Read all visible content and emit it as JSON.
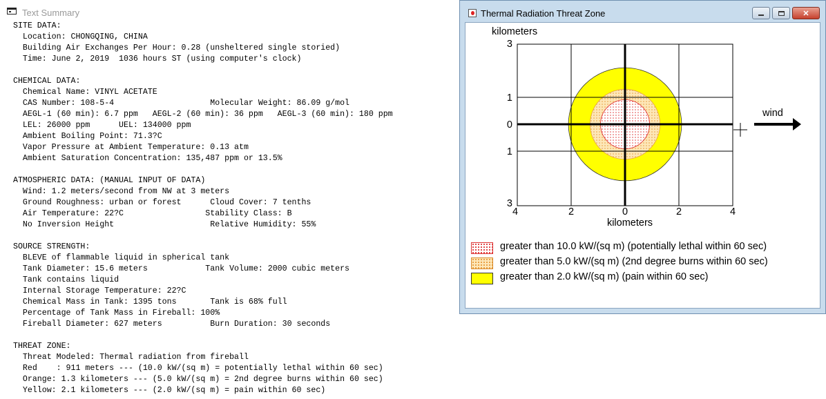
{
  "text_summary": {
    "title": "Text Summary",
    "lines": [
      "SITE DATA:",
      "  Location: CHONGQING, CHINA",
      "  Building Air Exchanges Per Hour: 0.28 (unsheltered single storied)",
      "  Time: June 2, 2019  1036 hours ST (using computer's clock)",
      "",
      "CHEMICAL DATA:",
      "  Chemical Name: VINYL ACETATE",
      "  CAS Number: 108-5-4                    Molecular Weight: 86.09 g/mol",
      "  AEGL-1 (60 min): 6.7 ppm   AEGL-2 (60 min): 36 ppm   AEGL-3 (60 min): 180 ppm",
      "  LEL: 26000 ppm      UEL: 134000 ppm",
      "  Ambient Boiling Point: 71.3?C",
      "  Vapor Pressure at Ambient Temperature: 0.13 atm",
      "  Ambient Saturation Concentration: 135,487 ppm or 13.5%",
      "",
      "ATMOSPHERIC DATA: (MANUAL INPUT OF DATA)",
      "  Wind: 1.2 meters/second from NW at 3 meters",
      "  Ground Roughness: urban or forest      Cloud Cover: 7 tenths",
      "  Air Temperature: 22?C                 Stability Class: B",
      "  No Inversion Height                    Relative Humidity: 55%",
      "",
      "SOURCE STRENGTH:",
      "  BLEVE of flammable liquid in spherical tank",
      "  Tank Diameter: 15.6 meters            Tank Volume: 2000 cubic meters",
      "  Tank contains liquid",
      "  Internal Storage Temperature: 22?C",
      "  Chemical Mass in Tank: 1395 tons       Tank is 68% full",
      "  Percentage of Tank Mass in Fireball: 100%",
      "  Fireball Diameter: 627 meters          Burn Duration: 30 seconds",
      "",
      "THREAT ZONE:",
      "  Threat Modeled: Thermal radiation from fireball",
      "  Red    : 911 meters --- (10.0 kW/(sq m) = potentially lethal within 60 sec)",
      "  Orange: 1.3 kilometers --- (5.0 kW/(sq m) = 2nd degree burns within 60 sec)",
      "  Yellow: 2.1 kilometers --- (2.0 kW/(sq m) = pain within 60 sec)"
    ]
  },
  "threat_window": {
    "title": "Thermal Radiation Threat Zone",
    "buttons": {
      "minimize": "minimize",
      "maximize": "maximize",
      "close": "close"
    },
    "close_glyph": "✕",
    "y_axis_label": "kilometers",
    "x_axis_label": "kilometers",
    "y_ticks": [
      {
        "label": "3",
        "value": 3
      },
      {
        "label": "1",
        "value": 1
      },
      {
        "label": "0",
        "value": 0
      },
      {
        "label": "1",
        "value": -1
      },
      {
        "label": "3",
        "value": -3
      }
    ],
    "x_ticks": [
      {
        "label": "4",
        "value": -4
      },
      {
        "label": "2",
        "value": -2
      },
      {
        "label": "0",
        "value": 0
      },
      {
        "label": "2",
        "value": 2
      },
      {
        "label": "4",
        "value": 4
      }
    ],
    "wind_label": "wind",
    "zones": [
      {
        "radius_km": 2.1,
        "color": "#ffff00",
        "pattern": "solid",
        "label": "greater than 2.0 kW/(sq m) (pain within 60 sec)"
      },
      {
        "radius_km": 1.3,
        "color": "#f0a040",
        "pattern": "dots",
        "label": "greater than 5.0 kW/(sq m) (2nd degree burns within 60 sec)"
      },
      {
        "radius_km": 0.911,
        "color": "#e03030",
        "pattern": "dots",
        "label": "greater than 10.0 kW/(sq m) (potentially lethal within 60 sec)"
      }
    ],
    "legend": [
      {
        "swatch": "red",
        "label": "greater than 10.0 kW/(sq m) (potentially lethal within 60 sec)"
      },
      {
        "swatch": "orange",
        "label": "greater than 5.0 kW/(sq m) (2nd degree burns within 60 sec)"
      },
      {
        "swatch": "yellow",
        "label": "greater than 2.0 kW/(sq m) (pain within 60 sec)"
      }
    ]
  }
}
